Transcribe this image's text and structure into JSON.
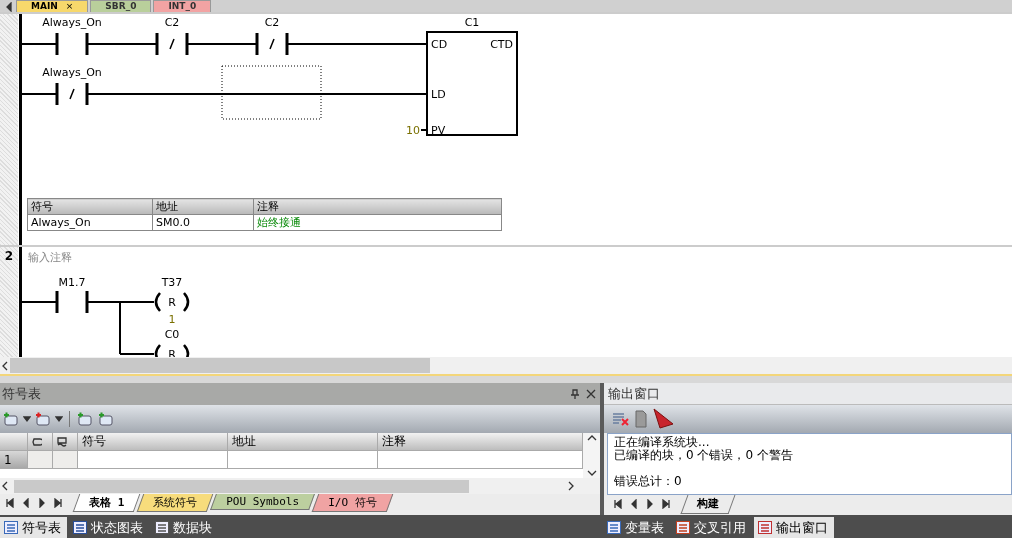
{
  "editor_tabs": [
    {
      "label": "MAIN",
      "selected": true,
      "color": "#f7d86b",
      "close": "×"
    },
    {
      "label": "SBR_0",
      "selected": false,
      "color": "#b9cf9b"
    },
    {
      "label": "INT_0",
      "selected": false,
      "color": "#f2a3a3"
    }
  ],
  "networks": [
    {
      "kind": "box",
      "rungs": [
        {
          "contacts": [
            {
              "operand": "Always_On",
              "kind": "no"
            },
            {
              "operand": "C2",
              "kind": "nc"
            },
            {
              "operand": "C2",
              "kind": "nc"
            }
          ]
        },
        {
          "contacts": [
            {
              "operand": "Always_On",
              "kind": "nc"
            }
          ]
        }
      ],
      "box": {
        "name": "C1",
        "type": "CTD",
        "pins": [
          "CD",
          "LD",
          "PV"
        ],
        "pv_value": "10"
      },
      "symbols": {
        "columns": [
          "符号",
          "地址",
          "注释"
        ],
        "rows": [
          [
            "Always_On",
            "SM0.0",
            "始终接通"
          ]
        ]
      }
    },
    {
      "kind": "coils",
      "number": "2",
      "comment": "输入注释",
      "contact": {
        "operand": "M1.7",
        "kind": "no"
      },
      "coils": [
        {
          "operand": "T37",
          "op": "R",
          "count": "1"
        },
        {
          "operand": "C0",
          "op": "R"
        }
      ]
    }
  ],
  "symbol_table": {
    "title": "符号表",
    "columns": [
      "符号",
      "地址",
      "注释"
    ],
    "rows": [
      {
        "number": "1"
      }
    ],
    "sheet_tabs": [
      {
        "label": "表格 1",
        "selected": true,
        "color": "#ffffff"
      },
      {
        "label": "系统符号",
        "selected": false,
        "color": "#f7dc7c"
      },
      {
        "label": "POU Symbols",
        "selected": false,
        "color": "#bccf9f"
      },
      {
        "label": "I/O 符号",
        "selected": false,
        "color": "#f0a3a3"
      }
    ]
  },
  "output_window": {
    "title": "输出窗口",
    "messages": [
      {
        "text": "正在编译系统块...",
        "kind": "line"
      },
      {
        "text": "已编译的块，0 个错误，0 个警告",
        "kind": "line"
      },
      {
        "text": "错误总计：0",
        "kind": "summary"
      }
    ],
    "tabs": [
      {
        "label": "构建",
        "selected": true
      }
    ]
  },
  "dock": {
    "left": [
      {
        "label": "符号表",
        "selected": true
      },
      {
        "label": "状态图表",
        "selected": false
      },
      {
        "label": "数据块",
        "selected": false
      }
    ],
    "right": [
      {
        "label": "变量表",
        "selected": false
      },
      {
        "label": "交叉引用",
        "selected": false
      },
      {
        "label": "输出窗口",
        "selected": true
      }
    ]
  }
}
